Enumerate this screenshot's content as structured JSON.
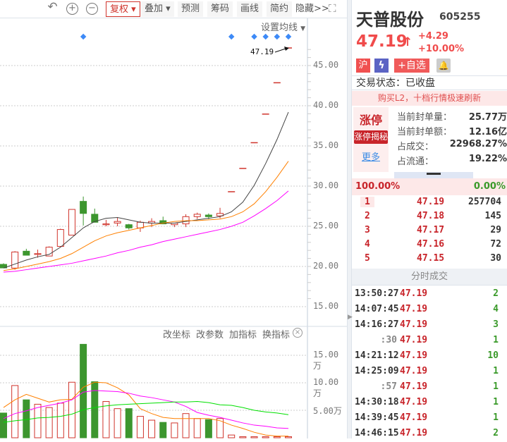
{
  "toolbar": {
    "buttons": [
      "复权",
      "叠加",
      "预测",
      "筹码",
      "画线",
      "简约",
      "隐藏>>"
    ],
    "icons": [
      "undo-icon",
      "zoom-in-icon",
      "zoom-out-icon",
      "fullscreen-icon"
    ]
  },
  "main_chart": {
    "ma_setting_label": "设置均线",
    "last_price_label": "47.19",
    "price_ticks": [
      "45.00",
      "40.00",
      "35.00",
      "30.00",
      "25.00",
      "20.00",
      "15.00"
    ]
  },
  "volume_chart": {
    "actions": [
      "改坐标",
      "改参数",
      "加指标",
      "换指标"
    ],
    "ticks": [
      "15.00万",
      "10.00万",
      "5.00万"
    ]
  },
  "chart_data": {
    "type": "candlestick",
    "price_axis": [
      15,
      45
    ],
    "candles": [
      [
        20.26,
        19.82,
        20.4,
        19.8
      ],
      [
        19.8,
        21.8,
        21.9,
        19.6
      ],
      [
        21.9,
        21.4,
        22.2,
        21.4
      ],
      [
        21.5,
        21.6,
        22.1,
        21.1
      ],
      [
        21.3,
        22.4,
        22.5,
        21.3
      ],
      [
        22.5,
        24.6,
        24.7,
        22.4
      ],
      [
        23.9,
        27.1,
        27.1,
        23.9
      ],
      [
        28.1,
        26.6,
        28.7,
        25.1
      ],
      [
        26.5,
        25.5,
        27.2,
        25.5
      ],
      [
        25.3,
        25.3,
        25.8,
        25.0
      ],
      [
        25.4,
        25.6,
        26.1,
        25.0
      ],
      [
        25.2,
        24.8,
        25.3,
        24.6
      ],
      [
        24.8,
        25.5,
        25.7,
        24.3
      ],
      [
        25.4,
        25.6,
        26.0,
        24.9
      ],
      [
        25.7,
        25.3,
        26.2,
        25.3
      ],
      [
        25.2,
        25.4,
        25.4,
        24.9
      ],
      [
        25.3,
        26.2,
        26.5,
        24.9
      ],
      [
        26.2,
        26.5,
        26.7,
        25.9
      ],
      [
        26.4,
        26.2,
        26.6,
        25.9
      ],
      [
        26.3,
        26.6,
        27.3,
        26.0
      ],
      [
        29.3,
        29.3,
        29.3,
        29.3
      ],
      [
        32.2,
        32.2,
        32.2,
        32.2
      ],
      [
        35.4,
        35.4,
        35.4,
        35.4
      ],
      [
        38.96,
        38.96,
        38.96,
        38.96
      ],
      [
        42.86,
        42.86,
        42.86,
        42.86
      ],
      [
        47.19,
        47.19,
        47.19,
        47.19
      ]
    ],
    "ma": [
      {
        "name": "MA5",
        "color": "#444444",
        "values": [
          19.8,
          20.3,
          20.8,
          21.2,
          21.5,
          22.4,
          23.6,
          24.8,
          25.6,
          26.0,
          26.1,
          25.8,
          25.5,
          25.4,
          25.4,
          25.4,
          25.6,
          25.8,
          26.0,
          26.2,
          26.8,
          28.0,
          30.1,
          32.8,
          35.8,
          39.2
        ]
      },
      {
        "name": "MA10",
        "color": "#ff8000",
        "values": [
          19.5,
          19.7,
          20.0,
          20.3,
          20.6,
          21.0,
          21.6,
          22.4,
          23.2,
          23.8,
          24.2,
          24.5,
          24.8,
          25.1,
          25.4,
          25.6,
          25.7,
          25.7,
          25.8,
          25.9,
          26.2,
          26.8,
          27.8,
          29.3,
          31.1,
          33.1
        ]
      },
      {
        "name": "MA20",
        "color": "#ff00ff",
        "values": [
          19.3,
          19.4,
          19.6,
          19.8,
          20.0,
          20.2,
          20.4,
          20.7,
          21.0,
          21.3,
          21.7,
          22.0,
          22.4,
          22.7,
          23.1,
          23.4,
          23.7,
          24.0,
          24.3,
          24.6,
          25.0,
          25.5,
          26.3,
          27.2,
          28.2,
          29.4
        ]
      }
    ],
    "signal_marks": [
      7,
      20,
      22,
      23,
      24,
      25
    ],
    "volume_unit": "万",
    "volume": [
      4.5,
      9.5,
      6.9,
      6.1,
      5.5,
      6.3,
      10.1,
      17.0,
      10.2,
      6.6,
      5.3,
      5.3,
      3.9,
      3.2,
      2.8,
      2.7,
      4.4,
      3.5,
      3.3,
      3.5,
      0.5,
      0.2,
      0.2,
      0.2,
      0.2,
      0.2
    ],
    "volume_ma": [
      {
        "name": "VMA5",
        "color": "#ff8000",
        "values": [
          5.5,
          6.9,
          7.9,
          7.2,
          6.5,
          6.9,
          7.0,
          9.2,
          10.1,
          10.0,
          9.1,
          7.8,
          5.3,
          4.4,
          3.7,
          3.5,
          3.5,
          3.5,
          3.5,
          3.1,
          2.3,
          1.7,
          1.0,
          0.5,
          0.3,
          0.3
        ]
      },
      {
        "name": "VMA10",
        "color": "#ff00ff",
        "values": [
          3.5,
          4.4,
          4.9,
          5.5,
          5.9,
          6.3,
          6.9,
          8.3,
          8.6,
          8.5,
          8.4,
          8.1,
          7.6,
          7.3,
          6.9,
          6.5,
          5.7,
          4.6,
          4.1,
          3.7,
          3.2,
          2.7,
          2.3,
          2.1,
          1.8,
          1.7
        ]
      },
      {
        "name": "VMA20",
        "color": "#00e000",
        "values": [
          2.8,
          3.1,
          3.3,
          3.6,
          3.7,
          3.9,
          4.3,
          5.1,
          5.5,
          5.8,
          6.0,
          6.1,
          6.2,
          6.3,
          6.4,
          6.5,
          6.5,
          6.6,
          6.4,
          6.0,
          5.9,
          5.5,
          5.0,
          4.7,
          4.5,
          4.2
        ]
      }
    ],
    "volume_axis": [
      0,
      17
    ]
  },
  "stock": {
    "name": "天普股份",
    "code": "605255",
    "price": "47.19",
    "arrow": "↑",
    "change": "+4.29",
    "change_pct": "+10.00%",
    "tags": [
      "沪",
      "ϟ",
      "+自选"
    ],
    "status": "交易状态：已收盘",
    "promo": "购买L2，十档行情极速刷新"
  },
  "limit": {
    "title": "涨停",
    "secret": "涨停揭秘",
    "more": "更多",
    "rows": [
      {
        "label": "当前封单量：",
        "value": "25.77万"
      },
      {
        "label": "当前封单额：",
        "value": "12.16亿"
      },
      {
        "label": "占成交：",
        "value": "22968.27%"
      },
      {
        "label": "占流通：",
        "value": "19.22%"
      }
    ]
  },
  "book": {
    "buy_pct": "100.00%",
    "sell_pct": "0.00%",
    "rows": [
      {
        "level": "1",
        "price": "47.19",
        "vol": "257704"
      },
      {
        "level": "2",
        "price": "47.18",
        "vol": "145"
      },
      {
        "level": "3",
        "price": "47.17",
        "vol": "29"
      },
      {
        "level": "4",
        "price": "47.16",
        "vol": "72"
      },
      {
        "level": "5",
        "price": "47.15",
        "vol": "30"
      }
    ]
  },
  "ticks": {
    "title": "分时成交",
    "rows": [
      {
        "time": "13:50:27",
        "price": "47.19",
        "vol": "2"
      },
      {
        "time": "14:07:45",
        "price": "47.19",
        "vol": "4"
      },
      {
        "time": "14:16:27",
        "price": "47.19",
        "vol": "3"
      },
      {
        "time": ":30",
        "price": "47.19",
        "vol": "1"
      },
      {
        "time": "14:21:12",
        "price": "47.19",
        "vol": "10"
      },
      {
        "time": "14:25:09",
        "price": "47.19",
        "vol": "1"
      },
      {
        "time": ":57",
        "price": "47.19",
        "vol": "1"
      },
      {
        "time": "14:30:18",
        "price": "47.19",
        "vol": "1"
      },
      {
        "time": "14:39:45",
        "price": "47.19",
        "vol": "1"
      },
      {
        "time": "14:46:15",
        "price": "47.19",
        "vol": "2"
      }
    ]
  }
}
